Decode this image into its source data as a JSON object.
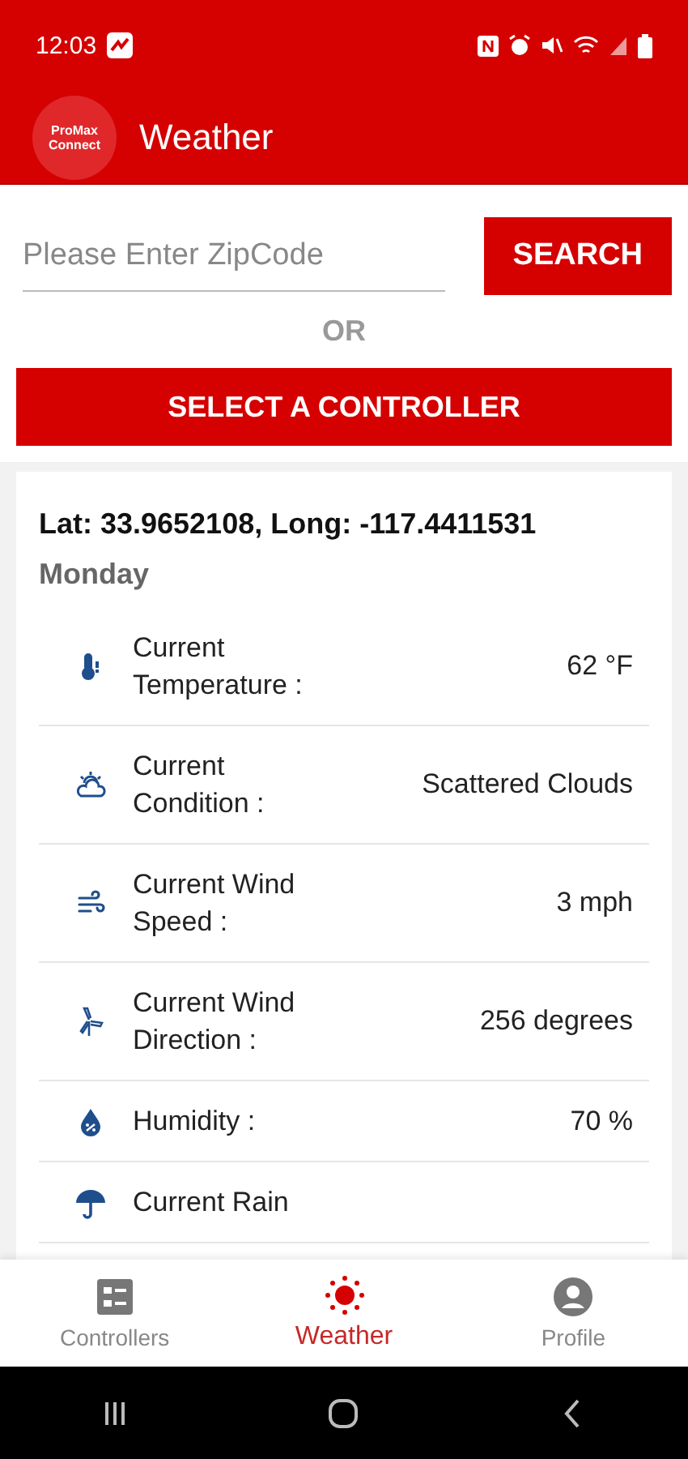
{
  "status_bar": {
    "time": "12:03"
  },
  "app_bar": {
    "logo_lines": [
      "ProMax",
      "Connect"
    ],
    "title": "Weather"
  },
  "search": {
    "placeholder": "Please Enter ZipCode",
    "button": "SEARCH"
  },
  "separator": "OR",
  "select_button": "SELECT A CONTROLLER",
  "location": {
    "coords": "Lat: 33.9652108, Long: -117.4411531",
    "day": "Monday"
  },
  "readings": [
    {
      "label": "Current Temperature :",
      "value": "62 °F"
    },
    {
      "label": "Current Condition :",
      "value": "Scattered Clouds"
    },
    {
      "label": "Current Wind Speed :",
      "value": "3 mph"
    },
    {
      "label": "Current Wind Direction :",
      "value": "256 degrees"
    },
    {
      "label": "Humidity :",
      "value": "70 %"
    },
    {
      "label": "Current Rain"
    }
  ],
  "bottom_nav": [
    {
      "label": "Controllers",
      "selected": false
    },
    {
      "label": "Weather",
      "selected": true
    },
    {
      "label": "Profile",
      "selected": false
    }
  ]
}
